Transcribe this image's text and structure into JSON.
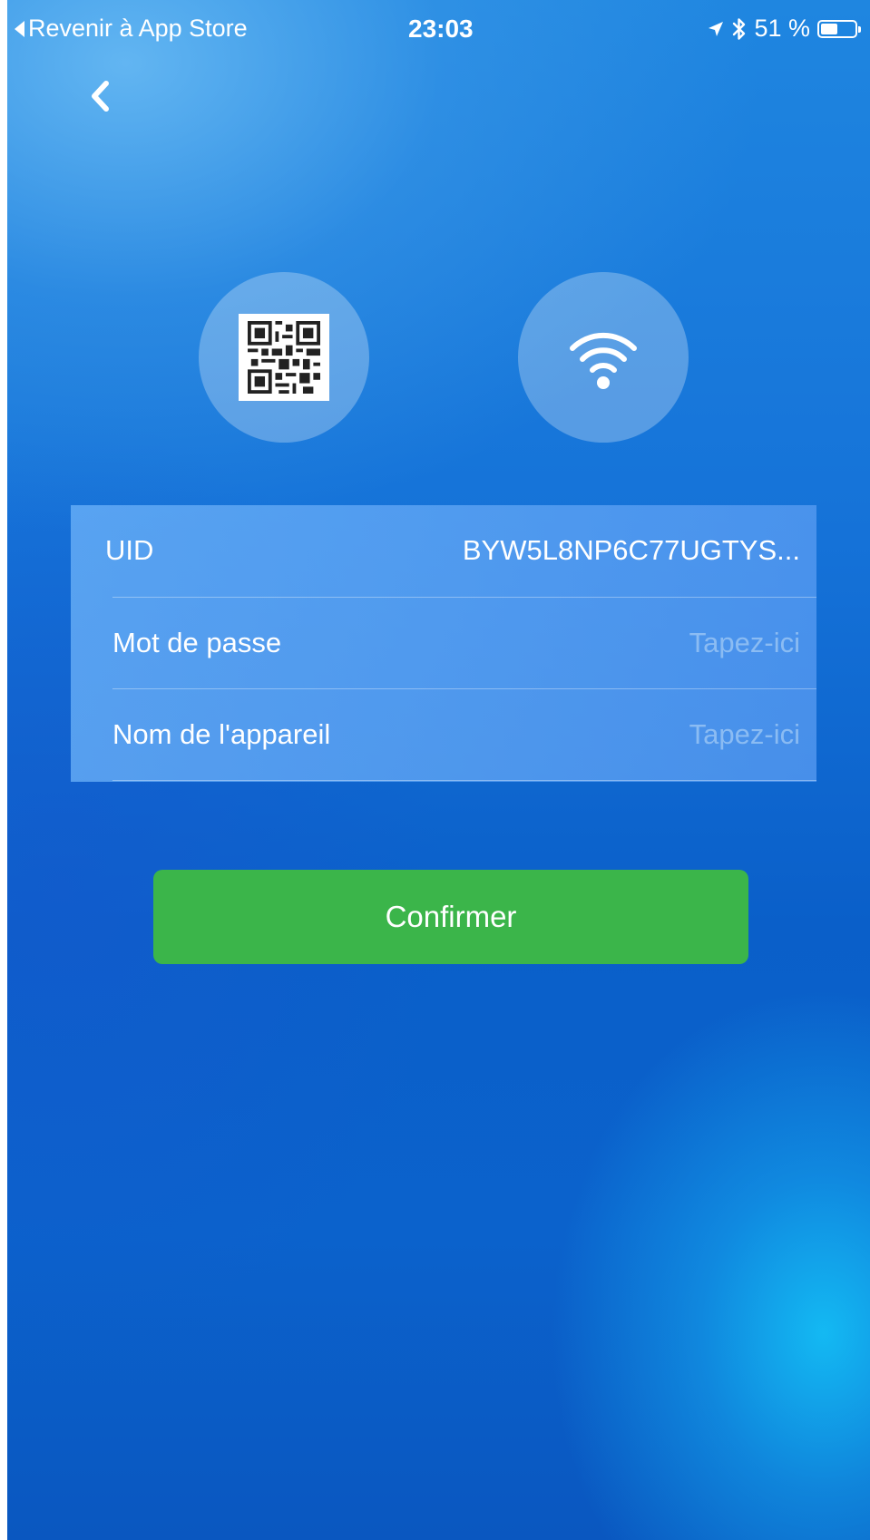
{
  "status_bar": {
    "back_app": "Revenir à App Store",
    "time": "23:03",
    "battery_percent": "51 %",
    "battery_level": 0.51,
    "icons": [
      "location-arrow-icon",
      "bluetooth-icon",
      "battery-icon"
    ]
  },
  "nav": {
    "back_icon": "chevron-left-icon"
  },
  "options": [
    {
      "name": "qr-code-icon"
    },
    {
      "name": "wifi-icon"
    }
  ],
  "form": {
    "uid": {
      "label": "UID",
      "value": "BYW5L8NP6C77UGTYS..."
    },
    "password": {
      "label": "Mot de passe",
      "placeholder": "Tapez-ici"
    },
    "device_name": {
      "label": "Nom de l'appareil",
      "placeholder": "Tapez-ici"
    }
  },
  "confirm_label": "Confirmer",
  "colors": {
    "confirm_green": "#3bb54a",
    "background_blue": "#1572d8"
  }
}
